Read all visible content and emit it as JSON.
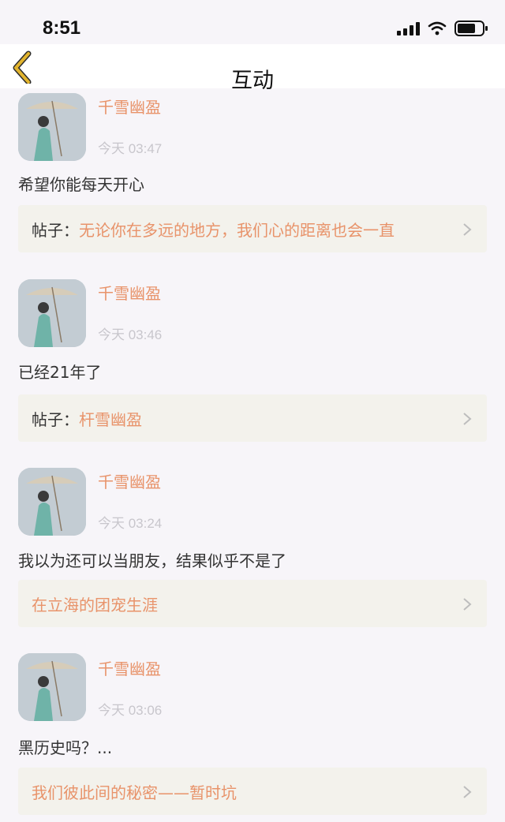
{
  "status_bar": {
    "time": "8:51"
  },
  "nav": {
    "title": "互动",
    "back_icon": "chevron-left-icon"
  },
  "colors": {
    "accent": "#e8936a",
    "back_arrow": "#e2b42e",
    "link_bg": "#f3f2ec"
  },
  "items": [
    {
      "username": "千雪幽盈",
      "time": "今天 03:47",
      "content": "希望你能每天开心",
      "post_prefix": "帖子：",
      "post_title": "无论你在多远的地方，我们心的距离也会一直"
    },
    {
      "username": "千雪幽盈",
      "time": "今天 03:46",
      "content": "已经21年了",
      "post_prefix": "帖子：",
      "post_title": "杆雪幽盈"
    },
    {
      "username": "千雪幽盈",
      "time": "今天 03:24",
      "content": "我以为还可以当朋友，结果似乎不是了",
      "post_prefix": "",
      "post_title": "在立海的团宠生涯"
    },
    {
      "username": "千雪幽盈",
      "time": "今天 03:06",
      "content": "黑历史吗？...",
      "post_prefix": "",
      "post_title": "我们彼此间的秘密——暂时坑"
    }
  ]
}
